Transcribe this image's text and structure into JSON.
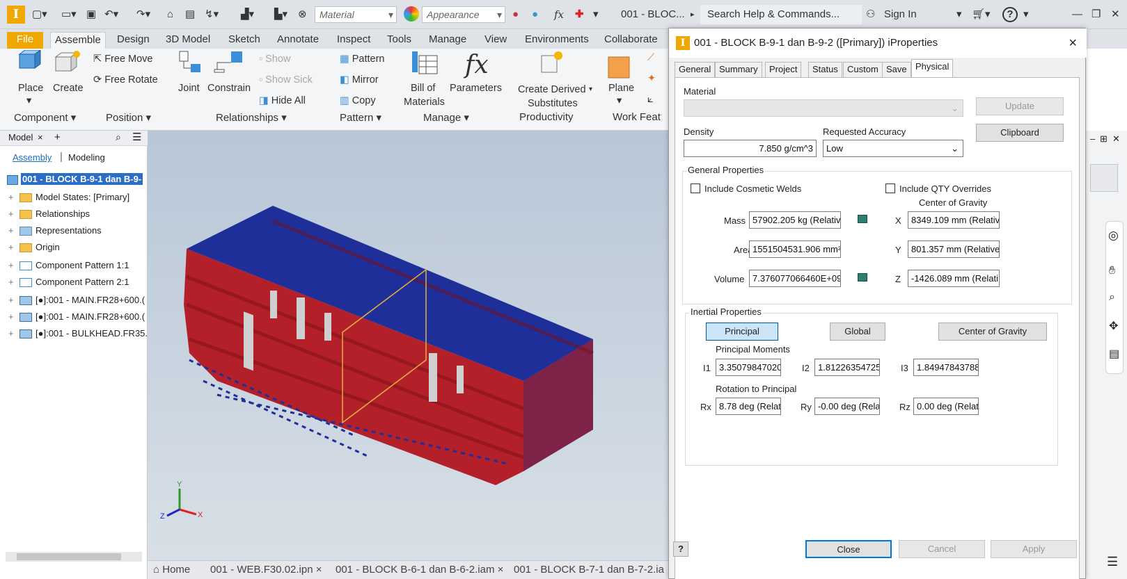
{
  "qat": {
    "material": "Material",
    "appearance": "Appearance",
    "fx": "fx",
    "doc_name": "001 - BLOC...",
    "search": "Search Help & Commands...",
    "signin": "Sign In",
    "help": "?"
  },
  "tabs": [
    "File",
    "Assemble",
    "Design",
    "3D Model",
    "Sketch",
    "Annotate",
    "Inspect",
    "Tools",
    "Manage",
    "View",
    "Environments",
    "Collaborate"
  ],
  "ribbon": {
    "place": "Place",
    "create": "Create",
    "free_move": "Free Move",
    "free_rotate": "Free Rotate",
    "joint": "Joint",
    "constrain": "Constrain",
    "show": "Show",
    "show_sick": "Show Sick",
    "hide_all": "Hide All",
    "pattern": "Pattern",
    "mirror": "Mirror",
    "copy": "Copy",
    "bom_1": "Bill of",
    "bom_2": "Materials",
    "parameters": "Parameters",
    "fx": "fx",
    "derived_1": "Create Derived",
    "derived_2": "Substitutes",
    "plane": "Plane",
    "panels": {
      "component": "Component ▾",
      "position": "Position ▾",
      "relationships": "Relationships ▾",
      "pattern": "Pattern ▾",
      "manage": "Manage ▾",
      "productivity": "Productivity",
      "workfeat": "Work Feat"
    }
  },
  "browser": {
    "tab": "Model",
    "close": "×",
    "add": "+",
    "sub_assembly": "Assembly",
    "sub_modeling": "Modeling",
    "root": "001 - BLOCK B-9-1 dan B-9-",
    "items": [
      "Model States: [Primary]",
      "Relationships",
      "Representations",
      "Origin",
      "Component Pattern 1:1",
      "Component Pattern 2:1",
      "[●]:001 - MAIN.FR28+600.(",
      "[●]:001 - MAIN.FR28+600.(",
      "[●]:001 - BULKHEAD.FR35.("
    ]
  },
  "doctabs": {
    "home": "Home",
    "t1": "001 - WEB.F30.02.ipn",
    "t2": "001 - BLOCK B-6-1 dan B-6-2.iam",
    "t3": "001 - BLOCK B-7-1 dan B-7-2.ia",
    "close": "×"
  },
  "dialog": {
    "title": "001 - BLOCK B-9-1 dan B-9-2 ([Primary]) iProperties",
    "close": "×",
    "tabs": [
      "General",
      "Summary",
      "Project",
      "Status",
      "Custom",
      "Save",
      "Physical"
    ],
    "material_label": "Material",
    "update": "Update",
    "clipboard": "Clipboard",
    "density_label": "Density",
    "density": "7.850 g/cm^3",
    "accuracy_label": "Requested Accuracy",
    "accuracy": "Low",
    "general_props": "General Properties",
    "cosmetic_welds": "Include Cosmetic Welds",
    "qty_overrides": "Include QTY Overrides",
    "cog": "Center of Gravity",
    "mass_label": "Mass",
    "mass": "57902.205 kg (Relativ",
    "area_label": "Area",
    "area": "1551504531.906 mm²",
    "volume_label": "Volume",
    "volume": "7.376077066460E+09",
    "x_label": "X",
    "x": "8349.109 mm (Relativ",
    "y_label": "Y",
    "y": "801.357 mm (Relative",
    "z_label": "Z",
    "z": "-1426.089 mm (Relati",
    "inertial_props": "Inertial Properties",
    "principal": "Principal",
    "global": "Global",
    "center_gravity": "Center of Gravity",
    "principal_moments": "Principal Moments",
    "i1_label": "I1",
    "i1": "3.35079847020",
    "i2_label": "I2",
    "i2": "1.81226354725",
    "i3_label": "I3",
    "i3": "1.84947843788",
    "rotation": "Rotation to Principal",
    "rx_label": "Rx",
    "rx": "8.78 deg (Relat",
    "ry_label": "Ry",
    "ry": "-0.00 deg (Rela",
    "rz_label": "Rz",
    "rz": "0.00 deg (Relat",
    "help": "?",
    "close_btn": "Close",
    "cancel": "Cancel",
    "apply": "Apply"
  },
  "colors": {
    "accent": "#f0a800",
    "hull_red": "#b3202a",
    "hull_blue": "#1f2f9a"
  }
}
